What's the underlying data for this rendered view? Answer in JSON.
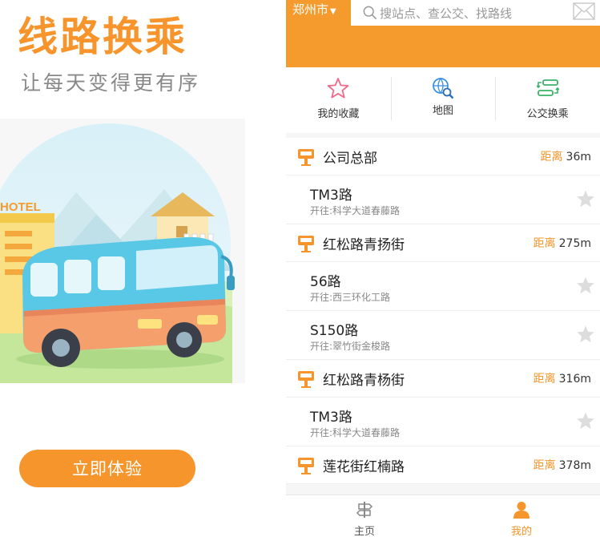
{
  "promo": {
    "title": "线路换乘",
    "subtitle": "让每天变得更有序",
    "hotel_sign": "HOTEL",
    "cta_label": "立即体验"
  },
  "app": {
    "city": "郑州市",
    "city_arrow_icon": "caret-down-icon",
    "search_placeholder": "搜站点、查公交、找路线",
    "quick_actions": [
      {
        "label": "我的收藏",
        "icon": "star-outline-icon"
      },
      {
        "label": "地图",
        "icon": "globe-search-icon"
      },
      {
        "label": "公交换乘",
        "icon": "transfer-icon"
      }
    ],
    "distance_prefix": "距离",
    "stops": [
      {
        "name": "公司总部",
        "distance": "36m",
        "routes": [
          {
            "name": "TM3路",
            "direction": "开往:科学大道春藤路"
          }
        ]
      },
      {
        "name": "红松路青扬街",
        "distance": "275m",
        "routes": [
          {
            "name": "56路",
            "direction": "开往:西三环化工路"
          },
          {
            "name": "S150路",
            "direction": "开往:翠竹街金梭路"
          }
        ]
      },
      {
        "name": "红松路青杨街",
        "distance": "316m",
        "routes": [
          {
            "name": "TM3路",
            "direction": "开往:科学大道春藤路"
          }
        ]
      },
      {
        "name": "莲花街红楠路",
        "distance": "378m",
        "routes": []
      }
    ],
    "tabs": [
      {
        "label": "主页",
        "icon": "signpost-icon",
        "active": false
      },
      {
        "label": "我的",
        "icon": "user-icon",
        "active": true
      }
    ],
    "colors": {
      "accent": "#f59b2d",
      "star": "#dddddd"
    }
  }
}
